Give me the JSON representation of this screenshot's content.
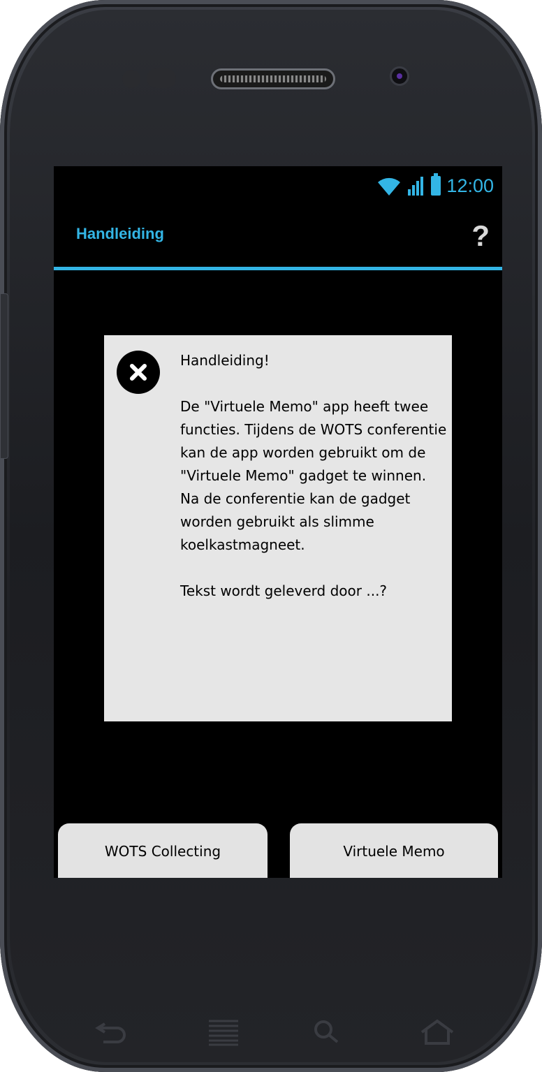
{
  "status_bar": {
    "time": "12:00",
    "icons": [
      "wifi-icon",
      "signal-icon",
      "battery-icon"
    ]
  },
  "action_bar": {
    "title": "Handleiding",
    "help_label": "?"
  },
  "dialog": {
    "title": "Handleiding!",
    "body": "De \"Virtuele Memo\" app heeft twee functies. Tijdens de WOTS conferentie kan de app worden gebruikt om de \"Virtuele Memo\" gadget te winnen. Na de conferentie kan de gadget worden gebruikt als slimme koelkastmagneet.",
    "footer": "Tekst wordt geleverd door ...?"
  },
  "tabs": [
    {
      "label": "WOTS Collecting"
    },
    {
      "label": "Virtuele Memo"
    }
  ],
  "nav_keys": [
    "back-icon",
    "menu-icon",
    "search-icon",
    "home-icon"
  ],
  "colors": {
    "accent": "#33b5e5",
    "dialog_bg": "#e6e6e6",
    "screen_bg": "#000000"
  }
}
